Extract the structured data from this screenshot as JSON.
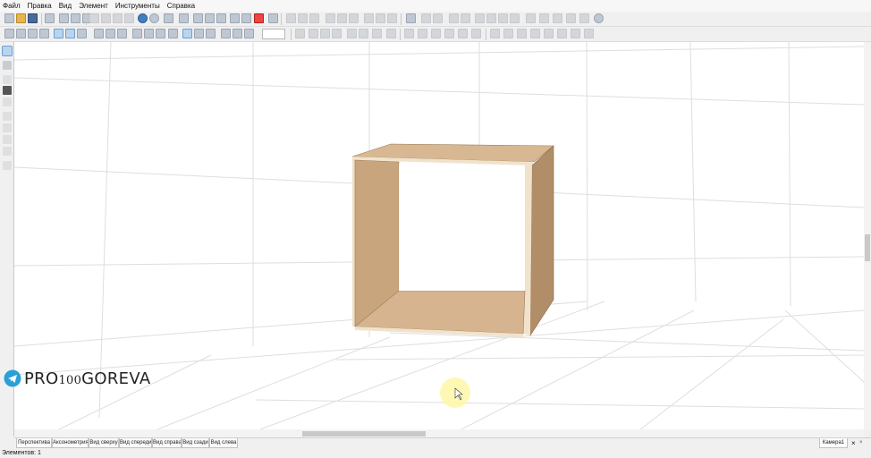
{
  "menu": [
    "Файл",
    "Правка",
    "Вид",
    "Элемент",
    "Инструменты",
    "Справка"
  ],
  "brand": {
    "pre": "PRO",
    "num": "100",
    "post": "GOREVA",
    "icon": "telegram-icon"
  },
  "view_tabs": [
    "Перспектива",
    "Аксонометрия",
    "Вид сверху",
    "Вид спереди",
    "Вид справа",
    "Вид сзади",
    "Вид слева"
  ],
  "camera": {
    "label": "Камера1",
    "close": "×",
    "close2": "×"
  },
  "status": {
    "text": "Элементов: 1"
  },
  "colors": {
    "panel_light": "#d8b893",
    "panel_mid": "#c9a57d",
    "panel_dark": "#b18d68",
    "edge": "#f1e2cc",
    "grid": "#dedede",
    "cursor_highlight": "#fff7a8"
  }
}
